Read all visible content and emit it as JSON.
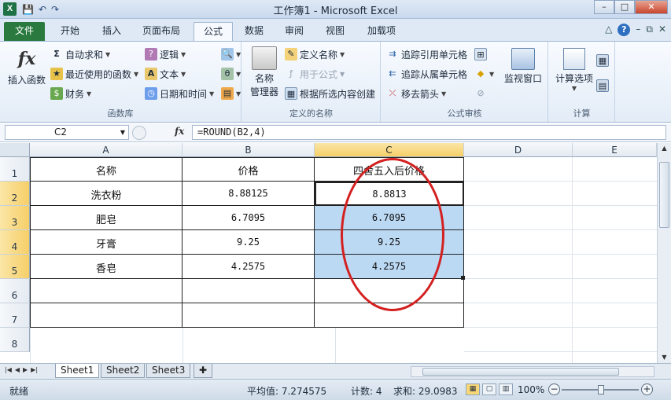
{
  "window": {
    "app_icon": "X",
    "title": "工作簿1 - Microsoft Excel"
  },
  "qat": {
    "save_icon": "💾",
    "undo_icon": "↶",
    "redo_icon": "↷"
  },
  "tabs": [
    {
      "label": "文件"
    },
    {
      "label": "开始"
    },
    {
      "label": "插入"
    },
    {
      "label": "页面布局"
    },
    {
      "label": "公式"
    },
    {
      "label": "数据"
    },
    {
      "label": "审阅"
    },
    {
      "label": "视图"
    },
    {
      "label": "加载项"
    }
  ],
  "ribbon": {
    "function_library": {
      "label": "函数库",
      "insert_function": "插入函数",
      "autosum": "自动求和",
      "recent": "最近使用的函数",
      "financial": "财务",
      "logical": "逻辑",
      "text": "文本",
      "datetime": "日期和时间"
    },
    "defined_names": {
      "label": "定义的名称",
      "name_manager_1": "名称",
      "name_manager_2": "管理器",
      "define_name": "定义名称",
      "use_in_formula": "用于公式",
      "create_from_selection": "根据所选内容创建"
    },
    "formula_auditing": {
      "label": "公式审核",
      "trace_precedents": "追踪引用单元格",
      "trace_dependents": "追踪从属单元格",
      "remove_arrows": "移去箭头",
      "watch_window": "监视窗口"
    },
    "calculation": {
      "label": "计算",
      "calc_options": "计算选项"
    }
  },
  "formula_bar": {
    "name_box": "C2",
    "fx": "fx",
    "formula": "=ROUND(B2,4)"
  },
  "columns": [
    "A",
    "B",
    "C",
    "D",
    "E"
  ],
  "rows": [
    "1",
    "2",
    "3",
    "4",
    "5",
    "6",
    "7",
    "8"
  ],
  "table": {
    "headers": [
      "名称",
      "价格",
      "四舍五入后价格"
    ],
    "data": [
      [
        "洗衣粉",
        "8.88125",
        "8.8813"
      ],
      [
        "肥皂",
        "6.7095",
        "6.7095"
      ],
      [
        "牙膏",
        "9.25",
        "9.25"
      ],
      [
        "香皂",
        "4.2575",
        "4.2575"
      ]
    ]
  },
  "sheets": [
    "Sheet1",
    "Sheet2",
    "Sheet3"
  ],
  "status": {
    "ready": "就绪",
    "average": "平均值: 7.274575",
    "count": "计数: 4",
    "sum": "求和: 29.0983",
    "zoom": "100%"
  },
  "colors": {
    "annotation": "#d32020",
    "selection": "#bcd9f4",
    "header_selected": "#f6cf68",
    "file_tab": "#2a7a40"
  }
}
